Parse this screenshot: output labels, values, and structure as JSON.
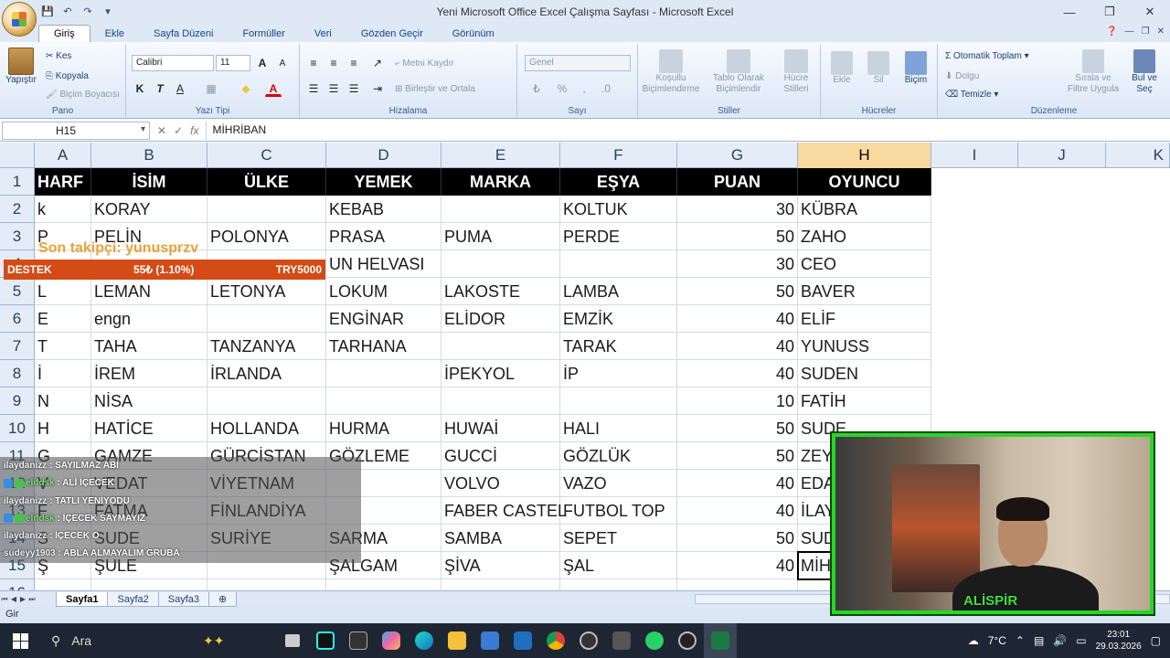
{
  "window": {
    "title": "Yeni Microsoft Office Excel Çalışma Sayfası - Microsoft Excel"
  },
  "tabs": [
    "Giriş",
    "Ekle",
    "Sayfa Düzeni",
    "Formüller",
    "Veri",
    "Gözden Geçir",
    "Görünüm"
  ],
  "ribbon": {
    "pano": {
      "label": "Pano",
      "paste": "Yapıştır",
      "cut": "Kes",
      "copy": "Kopyala",
      "format_painter": "Biçim Boyacısı"
    },
    "font": {
      "label": "Yazı Tipi",
      "name": "Calibri",
      "size": "11"
    },
    "align": {
      "label": "Hizalama",
      "wrap": "Metni Kaydır",
      "merge": "Birleştir ve Ortala"
    },
    "number": {
      "label": "Sayı",
      "format": "Genel"
    },
    "styles": {
      "label": "Stiller",
      "cond": "Koşullu Biçimlendirme",
      "table": "Tablo Olarak Biçimlendir",
      "cell": "Hücre Stilleri"
    },
    "cells": {
      "label": "Hücreler",
      "insert": "Ekle",
      "delete": "Sil",
      "format": "Biçim"
    },
    "edit": {
      "label": "Düzenleme",
      "autosum": "Otomatik Toplam",
      "fill": "Dolgu",
      "clear": "Temizle",
      "sort": "Sırala ve Filtre Uygula",
      "find": "Bul ve Seç"
    }
  },
  "formula_bar": {
    "namebox": "H15",
    "formula": "MİHRİBAN"
  },
  "columns": [
    "A",
    "B",
    "C",
    "D",
    "E",
    "F",
    "G",
    "H",
    "I",
    "J",
    "K"
  ],
  "rows": [
    "1",
    "2",
    "3",
    "4",
    "5",
    "6",
    "7",
    "8",
    "9",
    "10",
    "11",
    "12",
    "13",
    "14",
    "15",
    "16"
  ],
  "headers": {
    "harf": "HARF",
    "isim": "İSİM",
    "ulke": "ÜLKE",
    "yemek": "YEMEK",
    "marka": "MARKA",
    "esya": "EŞYA",
    "puan": "PUAN",
    "oyuncu": "OYUNCU"
  },
  "table": [
    {
      "a": "k",
      "b": "KORAY",
      "c": "",
      "d": "KEBAB",
      "e": "",
      "f": "KOLTUK",
      "g": "30",
      "h": "KÜBRA"
    },
    {
      "a": "P",
      "b": "PELİN",
      "c": "POLONYA",
      "d": "PRASA",
      "e": "PUMA",
      "f": "PERDE",
      "g": "50",
      "h": "ZAHO"
    },
    {
      "a": "",
      "b": "",
      "c": "",
      "d": "UN HELVASI",
      "e": "",
      "f": "",
      "g": "30",
      "h": "CEO"
    },
    {
      "a": "L",
      "b": "LEMAN",
      "c": "LETONYA",
      "d": "LOKUM",
      "e": "LAKOSTE",
      "f": "LAMBA",
      "g": "50",
      "h": "BAVER"
    },
    {
      "a": "E",
      "b": "engn",
      "c": "",
      "d": "ENGİNAR",
      "e": "ELİDOR",
      "f": "EMZİK",
      "g": "40",
      "h": "ELİF"
    },
    {
      "a": "T",
      "b": "TAHA",
      "c": "TANZANYA",
      "d": "TARHANA",
      "e": "",
      "f": "TARAK",
      "g": "40",
      "h": "YUNUSS"
    },
    {
      "a": "İ",
      "b": "İREM",
      "c": "İRLANDA",
      "d": "",
      "e": "İPEKYOL",
      "f": "İP",
      "g": "40",
      "h": "SUDEN"
    },
    {
      "a": "N",
      "b": "NİSA",
      "c": "",
      "d": "",
      "e": "",
      "f": "",
      "g": "10",
      "h": "FATİH"
    },
    {
      "a": "H",
      "b": "HATİCE",
      "c": "HOLLANDA",
      "d": "HURMA",
      "e": "HUWAİ",
      "f": "HALI",
      "g": "50",
      "h": "SUDE"
    },
    {
      "a": "G",
      "b": "GAMZE",
      "c": "GÜRCİSTAN",
      "d": "GÖZLEME",
      "e": "GUCCİ",
      "f": "GÖZLÜK",
      "g": "50",
      "h": "ZEY"
    },
    {
      "a": "V",
      "b": "VEDAT",
      "c": "VİYETNAM",
      "d": "",
      "e": "VOLVO",
      "f": "VAZO",
      "g": "40",
      "h": "EDA"
    },
    {
      "a": "F",
      "b": "FATMA",
      "c": "FİNLANDİYA",
      "d": "",
      "e": "FABER CASTEL",
      "f": "FUTBOL TOP",
      "g": "40",
      "h": "İLAY"
    },
    {
      "a": "S",
      "b": "SUDE",
      "c": "SURİYE",
      "d": "SARMA",
      "e": "SAMBA",
      "f": "SEPET",
      "g": "50",
      "h": "SUD"
    },
    {
      "a": "Ş",
      "b": "ŞULE",
      "c": "",
      "d": "ŞALGAM",
      "e": "ŞİVA",
      "f": "ŞAL",
      "g": "40",
      "h": "MİH"
    }
  ],
  "overlay": {
    "follower": "Son takipçi: yunusprzv",
    "donate_label": "DESTEK",
    "donate_progress": "55₺ (1.10%)",
    "donate_goal": "TRY5000",
    "chat": [
      {
        "user": "ilaydanizz",
        "msg": " : SAYILMAZ ABİ",
        "badge": ""
      },
      {
        "user": "elifdsk",
        "msg": " : ALİ İÇECEK",
        "badge": "b"
      },
      {
        "user": "ilaydanizz",
        "msg": " : TATLI YENİYODU",
        "badge": ""
      },
      {
        "user": "elifdsk",
        "msg": " : İÇECEK SAYMAYIZ",
        "badge": "b"
      },
      {
        "user": "ilaydanizz",
        "msg": " : İÇECEK O",
        "badge": ""
      },
      {
        "user": "sudeyy1903",
        "msg": " : ABLA ALMAYALIM GRUBA",
        "badge": ""
      }
    ],
    "cam_name": "ALİSPİR"
  },
  "sheets": [
    "Sayfa1",
    "Sayfa2",
    "Sayfa3"
  ],
  "status": "Gir",
  "taskbar": {
    "search": "Ara",
    "weather": "7°C",
    "time": "23:01",
    "date": "29.03.2026"
  }
}
